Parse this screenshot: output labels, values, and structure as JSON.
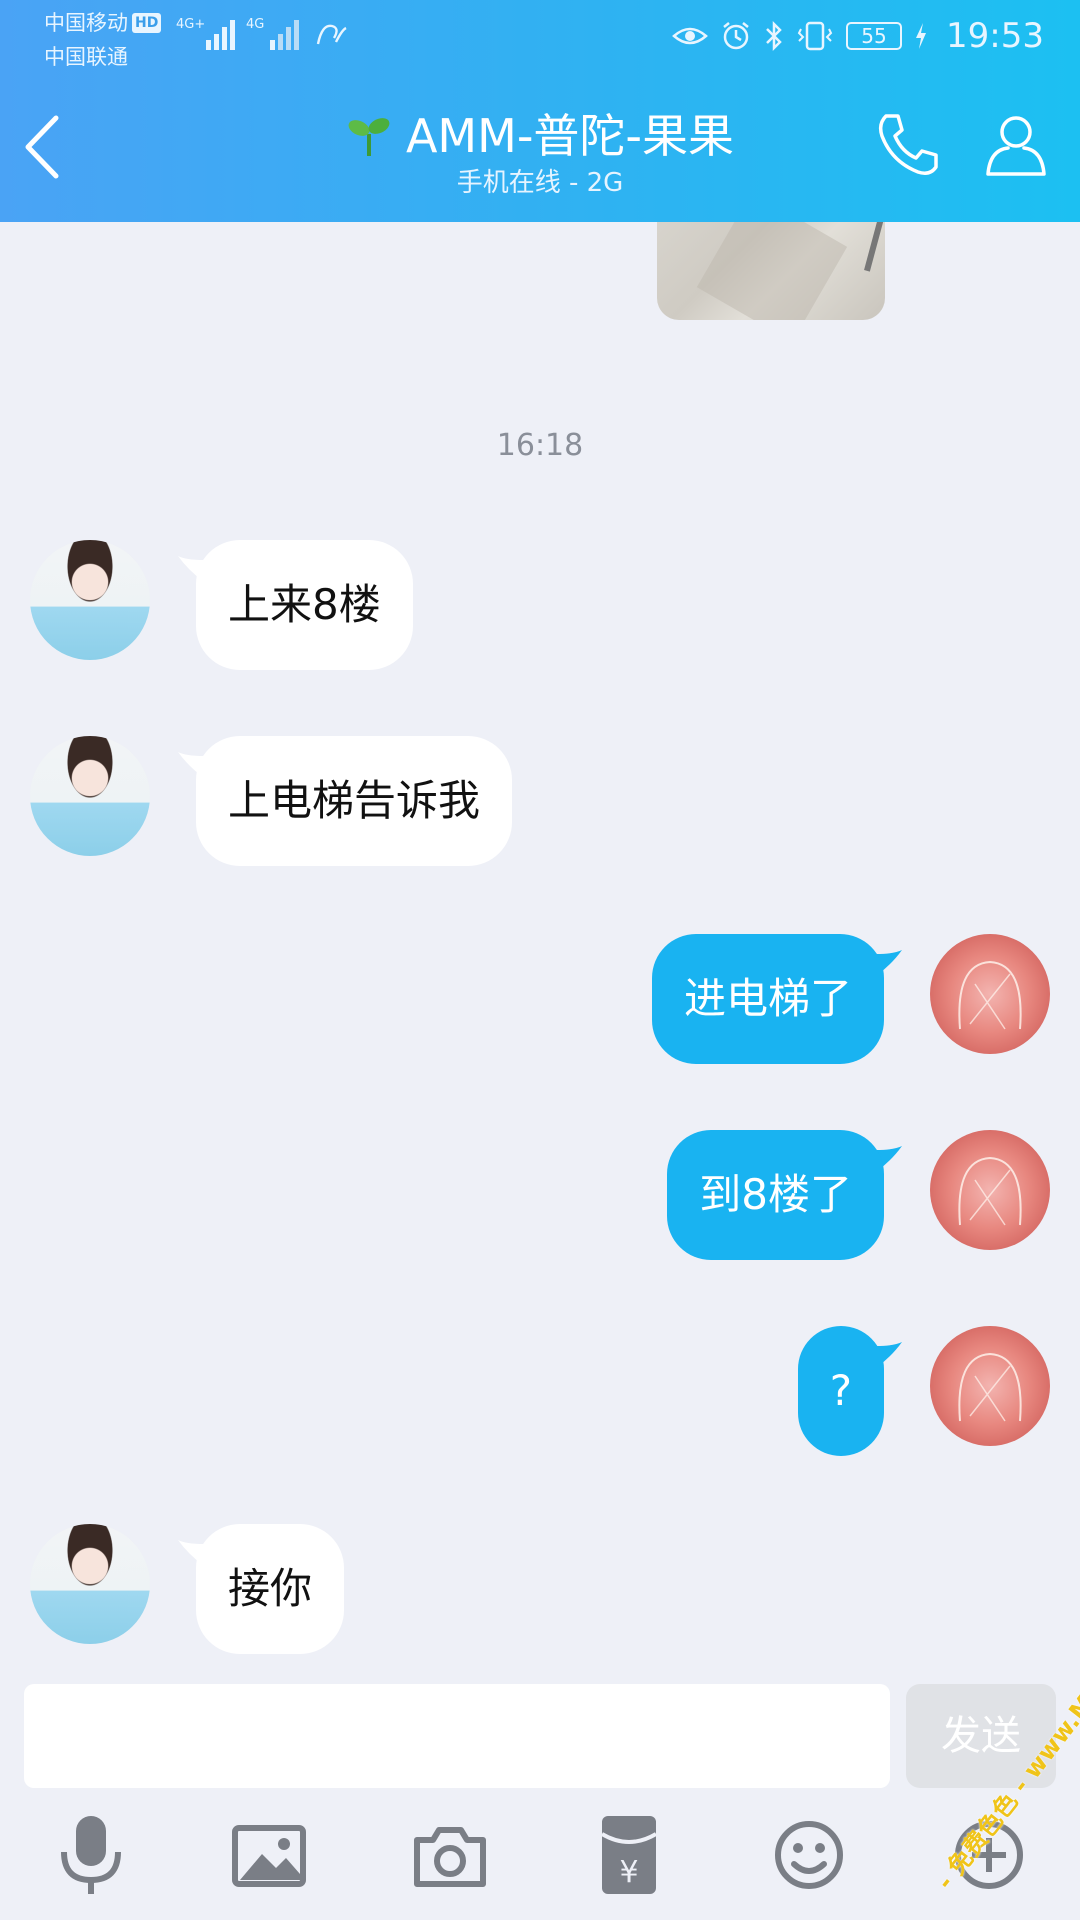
{
  "status_bar": {
    "carrier_1": "中国移动",
    "carrier_2": "中国联通",
    "hd_badge": "HD",
    "net_1": "4G+",
    "net_2": "4G",
    "battery": "55",
    "time": "19:53"
  },
  "header": {
    "title": "AMM-普陀-果果",
    "subtitle": "手机在线 - 2G"
  },
  "chat": {
    "timestamp": "16:18",
    "messages": [
      {
        "from": "them",
        "text": "上来8楼"
      },
      {
        "from": "them",
        "text": "上电梯告诉我"
      },
      {
        "from": "me",
        "text": "进电梯了"
      },
      {
        "from": "me",
        "text": "到8楼了"
      },
      {
        "from": "me",
        "text": "?"
      },
      {
        "from": "them",
        "text": "接你"
      }
    ]
  },
  "input": {
    "value": "",
    "send_label": "发送"
  },
  "toolbar": [
    "microphone-icon",
    "image-icon",
    "camera-icon",
    "red-packet-icon",
    "emoji-icon",
    "plus-icon"
  ],
  "watermark": "- 免费色色 - www.MFsese.com",
  "colors": {
    "header_start": "#4AA3F5",
    "header_end": "#1CC0F2",
    "outgoing_bubble": "#19B3F1",
    "incoming_bubble": "#FFFFFF",
    "background": "#EEF0F7",
    "send_disabled": "#E0E2E6"
  }
}
